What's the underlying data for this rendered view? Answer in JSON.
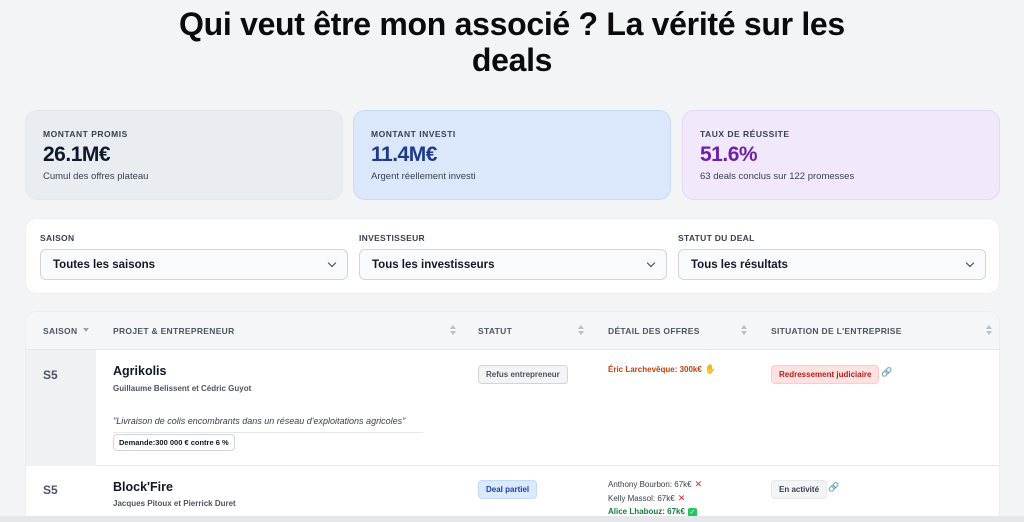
{
  "page": {
    "title_line1": "Qui veut être mon associé ? La vérité sur les",
    "title_line2": "deals"
  },
  "stats": [
    {
      "label": "MONTANT PROMIS",
      "value": "26.1M€",
      "sub": "Cumul des offres plateau"
    },
    {
      "label": "MONTANT INVESTI",
      "value": "11.4M€",
      "sub": "Argent réellement investi"
    },
    {
      "label": "TAUX DE RÉUSSITE",
      "value": "51.6%",
      "sub": "63 deals conclus sur 122 promesses"
    }
  ],
  "filters": [
    {
      "label": "SAISON",
      "value": "Toutes les saisons"
    },
    {
      "label": "INVESTISSEUR",
      "value": "Tous les investisseurs"
    },
    {
      "label": "STATUT DU DEAL",
      "value": "Tous les résultats"
    }
  ],
  "table": {
    "headers": [
      "SAISON",
      "PROJET & ENTREPRENEUR",
      "STATUT",
      "DÉTAIL DES OFFRES",
      "SITUATION DE L'ENTREPRISE"
    ],
    "rows": [
      {
        "saison": "S5",
        "project": "Agrikolis",
        "authors": "Guillaume Belissent et Cédric Guyot",
        "quote": "\"Livraison de colis encombrants dans un réseau d'exploitations agricoles\"",
        "demand": "Demande:300 000 € contre 6 %",
        "status": "Refus entrepreneur",
        "offers": [
          {
            "text": "Éric Larchevêque: 300k€",
            "mark": "✋"
          }
        ],
        "situation": "Redressement judiciaire"
      },
      {
        "saison": "S5",
        "project": "Block'Fire",
        "authors": "Jacques Pitoux et Pierrick Duret",
        "status": "Deal partiel",
        "offers": [
          {
            "text": "Anthony Bourbon: 67k€",
            "mark": "✕"
          },
          {
            "text": "Kelly Massol: 67k€",
            "mark": "✕"
          },
          {
            "text": "Alice Lhabouz: 67k€",
            "mark": "✓"
          }
        ],
        "situation": "En activité"
      }
    ]
  },
  "icons": {
    "link": "link-icon",
    "select": "chevron-down-icon",
    "sort": "sort-icon"
  },
  "colors": {
    "promis": "#0f172a",
    "investi": "#1e3a8a",
    "taux": "#6b21a8",
    "refus": "#dc2626",
    "ok": "#22c55e"
  }
}
